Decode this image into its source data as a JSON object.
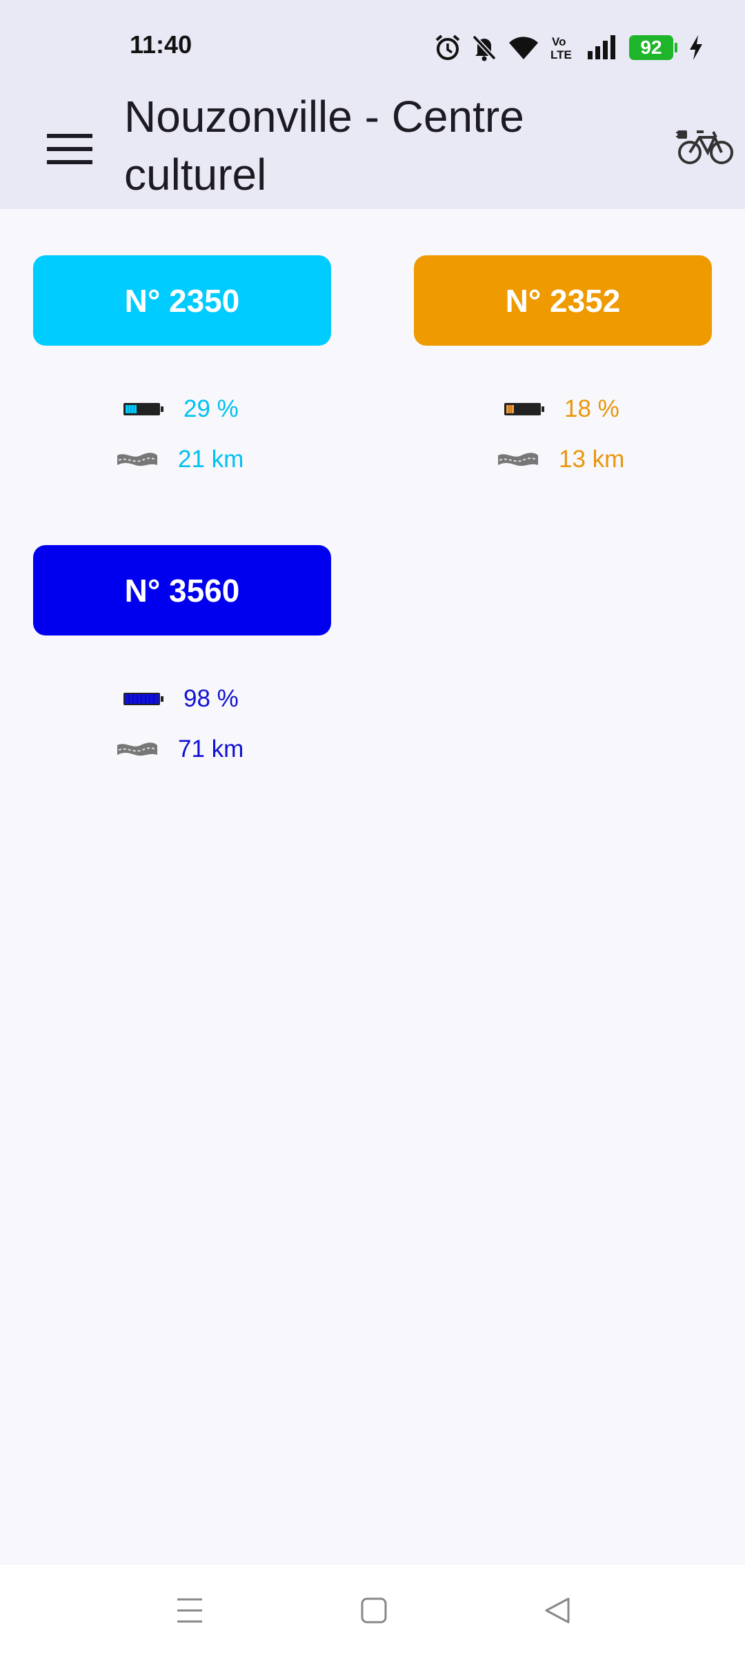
{
  "status_bar": {
    "time": "11:40",
    "battery_level": "92",
    "icons": [
      "alarm-icon",
      "bell-muted-icon",
      "wifi-icon",
      "volte-icon",
      "signal-icon",
      "battery-icon",
      "charging-bolt-icon"
    ]
  },
  "app_bar": {
    "title": "Nouzonville - Centre culturel",
    "menu_icon": "hamburger-menu-icon",
    "action_icon": "electric-bike-icon"
  },
  "bikes": [
    {
      "label": "N° 2350",
      "color": "#00ccff",
      "battery_pct": 29,
      "battery_text": "29 %",
      "range_text": "21 km"
    },
    {
      "label": "N° 2352",
      "color": "#ee9a00",
      "battery_pct": 18,
      "battery_text": "18 %",
      "range_text": "13 km"
    },
    {
      "label": "N° 3560",
      "color": "#0000ee",
      "battery_pct": 98,
      "battery_text": "98 %",
      "range_text": "71 km"
    }
  ],
  "nav_bar": {
    "items": [
      "recents-icon",
      "home-icon",
      "back-icon"
    ]
  },
  "colors": {
    "header_bg": "#e9e8f5",
    "page_bg": "#f8f7fc",
    "status_battery": "#1fb52a"
  }
}
